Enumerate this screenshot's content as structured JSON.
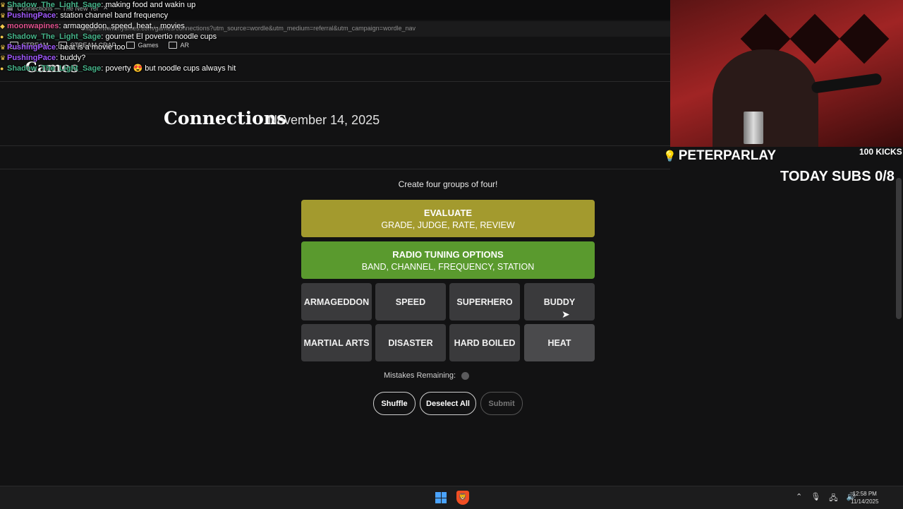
{
  "browser": {
    "tab_title": "Connections — The New Yor",
    "url": "https://www.nytimes.com/games/connections?utm_source=wordle&utm_medium=referral&utm_campaign=wordle_nav",
    "bookmarks": [
      "STREAM",
      "STREAM CRAP",
      "Games",
      "AR"
    ],
    "site_logo": "Games"
  },
  "chat": [
    {
      "user": "Shadow_The_Light_Sage",
      "color": "green",
      "badge": "crown",
      "msg": "making food and wakin up"
    },
    {
      "user": "PushingPace",
      "color": "purple",
      "badge": "crown",
      "msg": "station channel band frequency"
    },
    {
      "user": "moonwapines",
      "color": "pink",
      "badge": "gem",
      "msg": "armageddon, speed, heat... movies"
    },
    {
      "user": "Shadow_The_Light_Sage",
      "color": "green",
      "badge": "pin",
      "msg": "gourmet El povertio noodle cups"
    },
    {
      "user": "PushingPace",
      "color": "purple",
      "badge": "crown",
      "msg": "heat is a movie too"
    },
    {
      "user": "PushingPace",
      "color": "purple",
      "badge": "crown",
      "msg": "buddy?"
    },
    {
      "user": "Shadow_The_Light_Sage",
      "color": "green",
      "badge": "pin",
      "msg": "poverty 😍 but noodle cups always hit"
    }
  ],
  "header": {
    "title": "Connections",
    "date": "November 14, 2025"
  },
  "game": {
    "instruction": "Create four groups of four!",
    "solved": [
      {
        "category": "EVALUATE",
        "words": "GRADE, JUDGE, RATE, REVIEW",
        "color": "#a39a2e"
      },
      {
        "category": "RADIO TUNING OPTIONS",
        "words": "BAND, CHANNEL, FREQUENCY, STATION",
        "color": "#5a9a2e"
      }
    ],
    "tiles": [
      "ARMAGEDDON",
      "SPEED",
      "SUPERHERO",
      "BUDDY",
      "MARTIAL ARTS",
      "DISASTER",
      "HARD BOILED",
      "HEAT"
    ],
    "mistakes_label": "Mistakes Remaining:",
    "mistakes_remaining": 1,
    "buttons": {
      "shuffle": "Shuffle",
      "deselect": "Deselect All",
      "submit": "Submit"
    }
  },
  "stream": {
    "streamer": "PETERPARLAY",
    "kicks": "100 KICKS",
    "subs": "TODAY SUBS 0/8"
  },
  "taskbar": {
    "time": "12:58 PM",
    "date": "11/14/2025"
  }
}
